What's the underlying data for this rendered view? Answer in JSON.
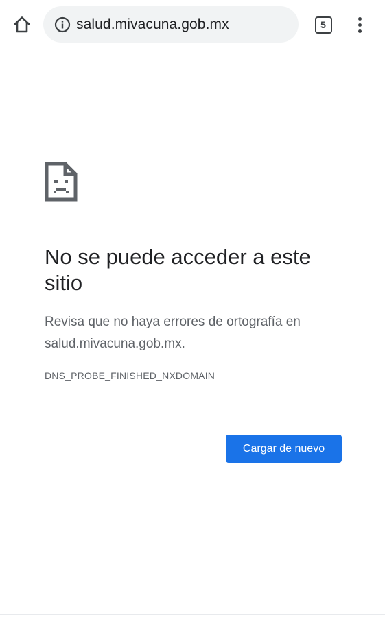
{
  "toolbar": {
    "home_icon": "home-icon",
    "info_icon": "info-icon",
    "url": "salud.mivacuna.gob.mx",
    "tab_count": "5",
    "menu_icon": "more-vert-icon"
  },
  "error_page": {
    "icon": "sad-page-icon",
    "title": "No se puede acceder a este sitio",
    "description": "Revisa que no haya errores de ortografía en salud.mivacuna.gob.mx.",
    "error_code": "DNS_PROBE_FINISHED_NXDOMAIN",
    "reload_label": "Cargar de nuevo"
  },
  "colors": {
    "accent": "#1a73e8",
    "omnibox_bg": "#f1f3f4",
    "text_primary": "#202124",
    "text_secondary": "#5f6368"
  }
}
